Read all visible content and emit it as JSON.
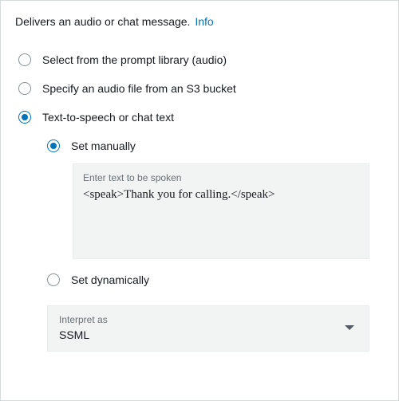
{
  "header": {
    "description": "Delivers an audio or chat message.",
    "info_label": "Info"
  },
  "options": [
    {
      "label": "Select from the prompt library (audio)"
    },
    {
      "label": "Specify an audio file from an S3 bucket"
    },
    {
      "label": "Text-to-speech or chat text"
    }
  ],
  "tts_sub_options": [
    {
      "label": "Set manually"
    },
    {
      "label": "Set dynamically"
    }
  ],
  "tts_textarea": {
    "placeholder": "Enter text to be spoken",
    "value": "<speak>Thank you for calling.</speak>"
  },
  "interpret_as": {
    "label": "Interpret as",
    "value": "SSML"
  }
}
